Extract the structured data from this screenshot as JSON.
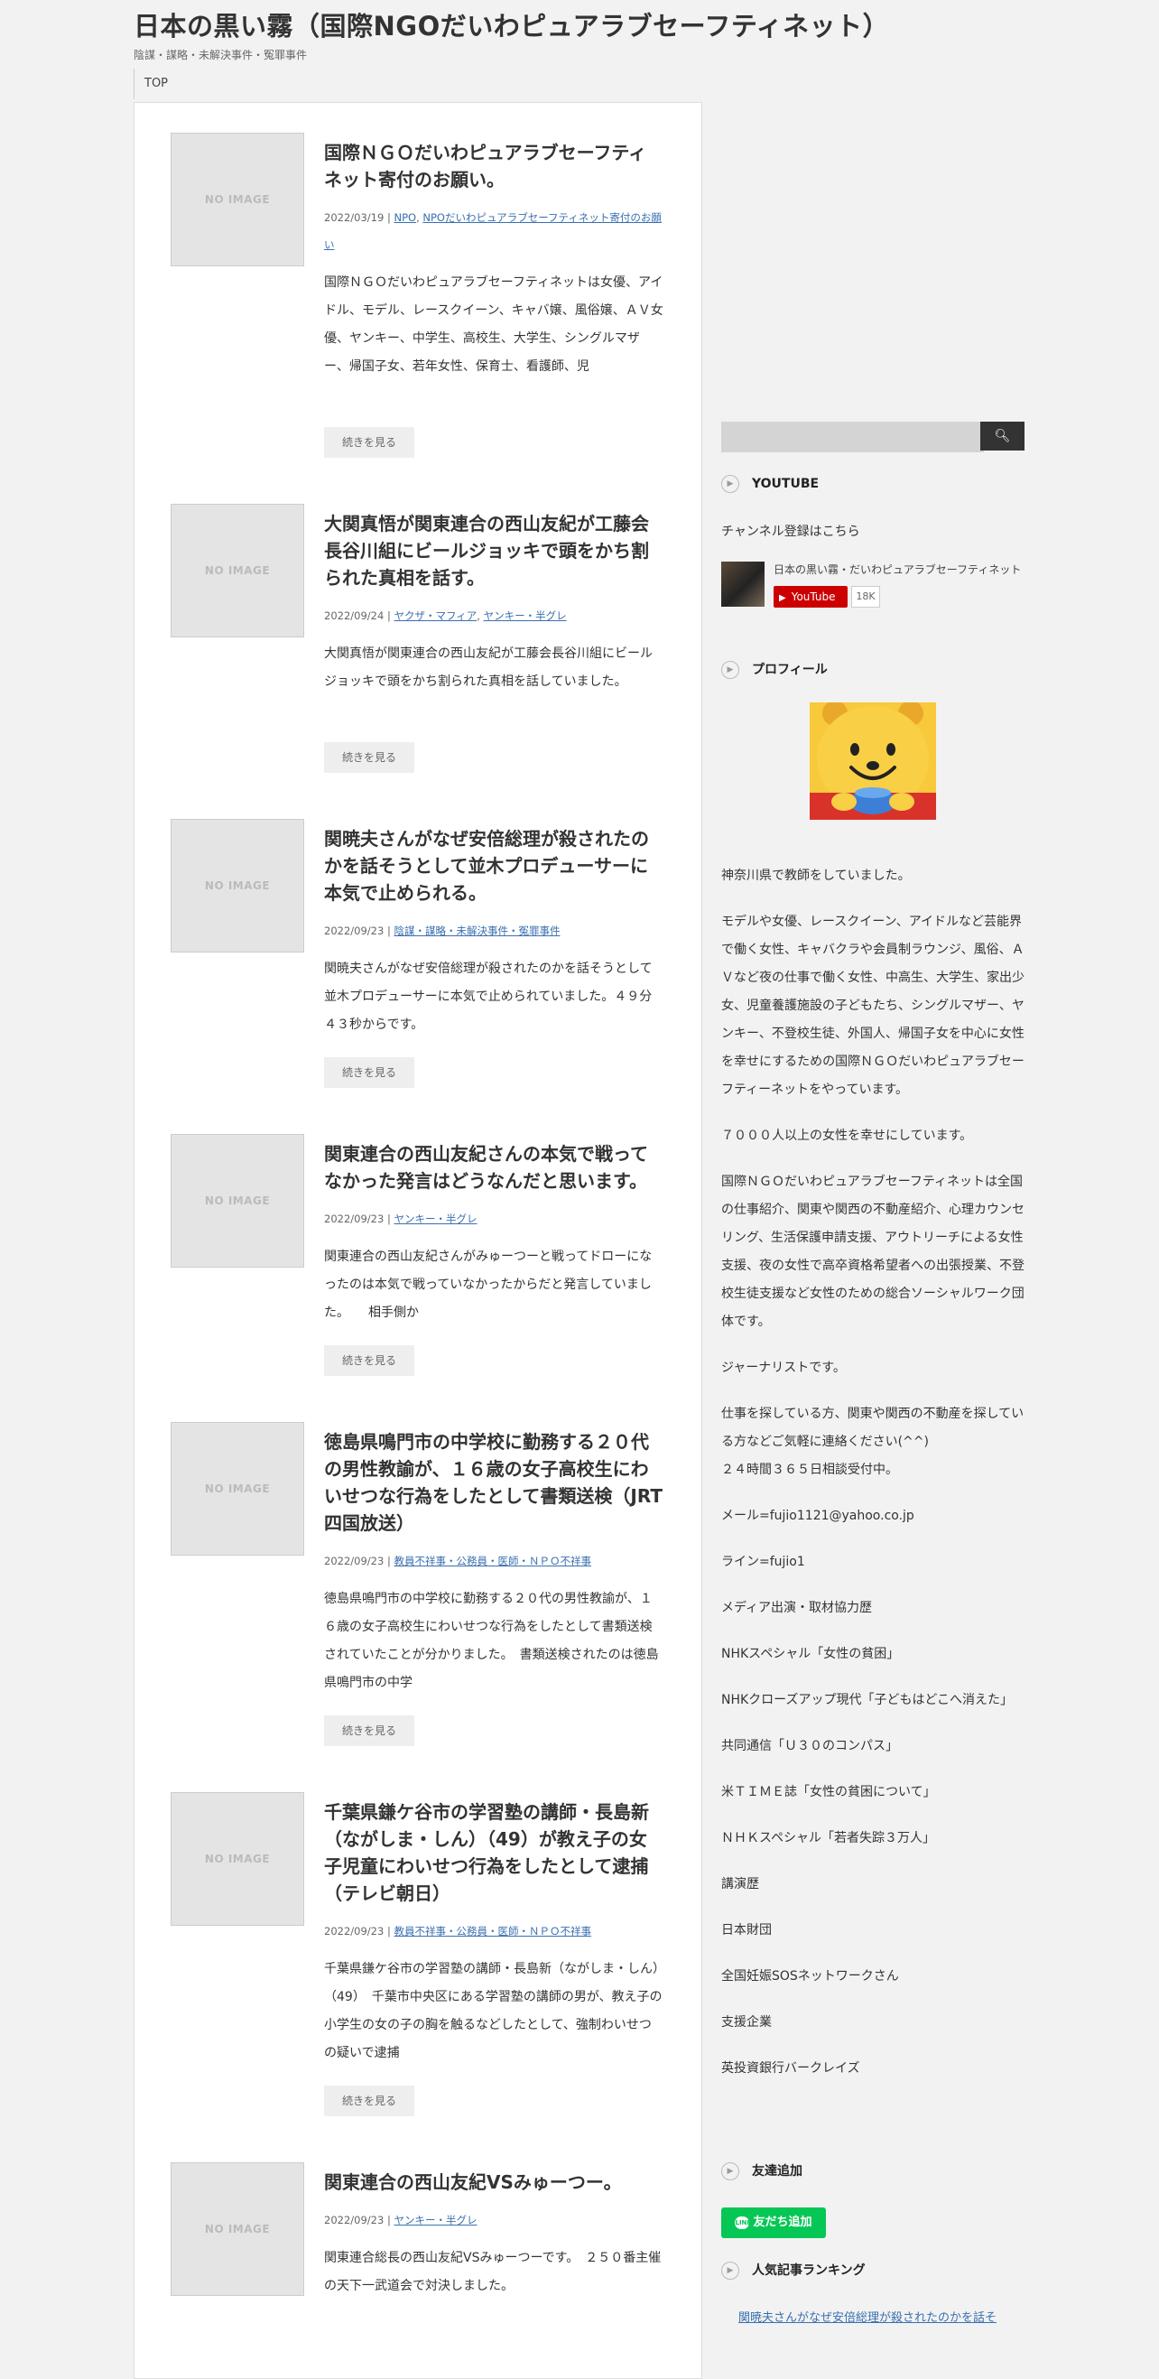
{
  "site": {
    "title": "日本の黒い霧（国際NGOだいわピュアラブセーフティネット）",
    "description": "陰謀・謀略・未解決事件・冤罪事件"
  },
  "nav": {
    "top": "TOP"
  },
  "thumb_label": "NO IMAGE",
  "more_label": "続きを見る",
  "posts": [
    {
      "title": "国際ＮＧＯだいわピュアラブセーフティネット寄付のお願い。",
      "date": "2022/03/19",
      "cats": [
        "NPO",
        "NPOだいわピュアラブセーフティネット寄付のお願い"
      ],
      "excerpt": "国際ＮＧＯだいわピュアラブセーフティネットは女優、アイドル、モデル、レースクイーン、キャバ嬢、風俗嬢、ＡＶ女優、ヤンキー、中学生、高校生、大学生、シングルマザー、帰国子女、若年女性、保育士、看護師、児"
    },
    {
      "title": "大関真悟が関東連合の西山友紀が工藤会長谷川組にビールジョッキで頭をかち割られた真相を話す。",
      "date": "2022/09/24",
      "cats": [
        "ヤクザ・マフィア",
        "ヤンキー・半グレ"
      ],
      "excerpt": "大関真悟が関東連合の西山友紀が工藤会長谷川組にビールジョッキで頭をかち割られた真相を話していました。"
    },
    {
      "title": "関暁夫さんがなぜ安倍総理が殺されたのかを話そうとして並木プロデューサーに本気で止められる。",
      "date": "2022/09/23",
      "cats": [
        "陰謀・謀略・未解決事件・冤罪事件"
      ],
      "excerpt": "関暁夫さんがなぜ安倍総理が殺されたのかを話そうとして並木プロデューサーに本気で止められていました。４９分４３秒からです。"
    },
    {
      "title": "関東連合の西山友紀さんの本気で戦ってなかった発言はどうなんだと思います。",
      "date": "2022/09/23",
      "cats": [
        "ヤンキー・半グレ"
      ],
      "excerpt": "関東連合の西山友紀さんがみゅーつーと戦ってドローになったのは本気で戦っていなかったからだと発言していました。　　相手側か"
    },
    {
      "title": "徳島県鳴門市の中学校に勤務する２０代の男性教諭が、１６歳の女子高校生にわいせつな行為をしたとして書類送検（JRT四国放送）",
      "date": "2022/09/23",
      "cats": [
        "教員不祥事・公務員・医師・ＮＰＯ不祥事"
      ],
      "excerpt": "徳島県鳴門市の中学校に勤務する２０代の男性教諭が、１６歳の女子高校生にわいせつな行為をしたとして書類送検されていたことが分かりました。　書類送検されたのは徳島県鳴門市の中学"
    },
    {
      "title": "千葉県鎌ケ谷市の学習塾の講師・長島新（ながしま・しん）（49）が教え子の女子児童にわいせつ行為をしたとして逮捕（テレビ朝日）",
      "date": "2022/09/23",
      "cats": [
        "教員不祥事・公務員・医師・ＮＰＯ不祥事"
      ],
      "excerpt": "千葉県鎌ケ谷市の学習塾の講師・長島新（ながしま・しん）（49）　千葉市中央区にある学習塾の講師の男が、教え子の小学生の女の子の胸を触るなどしたとして、強制わいせつの疑いで逮捕"
    },
    {
      "title": "関東連合の西山友紀VSみゅーつー。",
      "date": "2022/09/23",
      "cats": [
        "ヤンキー・半グレ"
      ],
      "excerpt": "関東連合総長の西山友紀VSみゅーつーです。　２５０番主催の天下一武道会で対決しました。"
    }
  ],
  "sidebar": {
    "youtube_title": "YOUTUBE",
    "youtube_text": "チャンネル登録はこちら",
    "youtube_channel": "日本の黒い霧・だいわピュアラブセーフティネット",
    "youtube_button": "YouTube",
    "youtube_count": "18K",
    "profile_title": "プロフィール",
    "profile_paragraphs": [
      "神奈川県で教師をしていました。",
      "モデルや女優、レースクイーン、アイドルなど芸能界で働く女性、キャバクラや会員制ラウンジ、風俗、ＡＶなど夜の仕事で働く女性、中高生、大学生、家出少女、児童養護施設の子どもたち、シングルマザー、ヤンキー、不登校生徒、外国人、帰国子女を中心に女性を幸せにするための国際ＮＧＯだいわピュアラブセーフティーネットをやっています。",
      "７０００人以上の女性を幸せにしています。",
      "国際ＮＧＯだいわピュアラブセーフティネットは全国の仕事紹介、関東や関西の不動産紹介、心理カウンセリング、生活保護申請支援、アウトリーチによる女性支援、夜の女性で高卒資格希望者への出張授業、不登校生徒支援など女性のための総合ソーシャルワーク団体です。",
      "ジャーナリストです。",
      "仕事を探している方、関東や関西の不動産を探している方などご気軽に連絡ください(^^)",
      "２４時間３６５日相談受付中。",
      "メール=fujio1121@yahoo.co.jp",
      "ライン=fujio1",
      "メディア出演・取材協力歴",
      "NHKスペシャル「女性の貧困」",
      "NHKクローズアップ現代「子どもはどこへ消えた」",
      "共同通信「Ｕ３０のコンパス」",
      "米ＴＩＭＥ誌「女性の貧困について」",
      "ＮＨＫスペシャル「若者失踪３万人」",
      "講演歴",
      "日本財団",
      "全国妊娠SOSネットワークさん",
      "支援企業",
      "英投資銀行バークレイズ"
    ],
    "friend_title": "友達追加",
    "line_button": "友だち追加",
    "ranking_title": "人気記事ランキング",
    "ranking_first": "関暁夫さんがなぜ安倍総理が殺されたのかを話そ"
  }
}
